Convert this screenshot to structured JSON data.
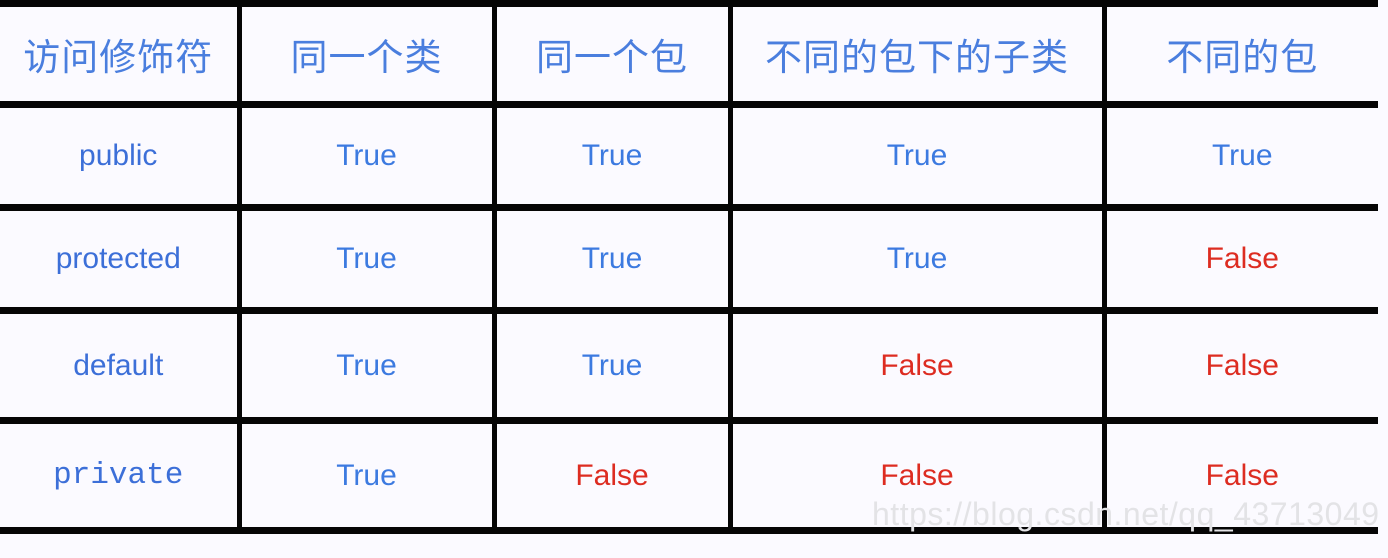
{
  "table": {
    "headers": [
      "访问修饰符",
      "同一个类",
      "同一个包",
      "不同的包下的子类",
      "不同的包"
    ],
    "rows": [
      {
        "modifier": "public",
        "mono": false,
        "values": [
          "True",
          "True",
          "True",
          "True"
        ]
      },
      {
        "modifier": "protected",
        "mono": false,
        "values": [
          "True",
          "True",
          "True",
          "False"
        ]
      },
      {
        "modifier": "default",
        "mono": false,
        "values": [
          "True",
          "True",
          "False",
          "False"
        ]
      },
      {
        "modifier": "private",
        "mono": true,
        "values": [
          "True",
          "False",
          "False",
          "False"
        ]
      }
    ]
  },
  "watermark": {
    "text": "https://blog.csdn.net/qq_43713049"
  },
  "colors": {
    "true_text": "#3c7ae0",
    "false_text": "#dd2c21",
    "header_text": "#4a7ede",
    "modifier_text": "#3c6fd8",
    "border": "#050505",
    "background": "#fbfaff",
    "watermark_text": "#e3e3e6"
  }
}
